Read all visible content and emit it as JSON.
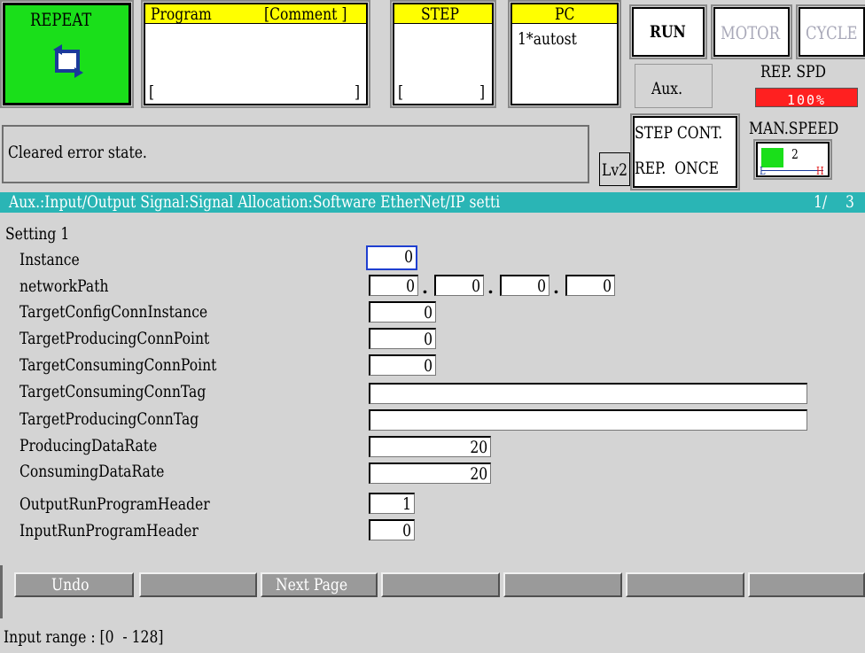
{
  "repeat": {
    "label": "REPEAT",
    "icon": "repeat-cycle-icon"
  },
  "program": {
    "label": "Program",
    "comment_label": "[Comment ]",
    "name_bracket_open": "[",
    "name_bracket_close": "]"
  },
  "step": {
    "label": "STEP",
    "bracket_open": "[",
    "bracket_close": "]"
  },
  "pc": {
    "label": "PC",
    "value": "1*autost"
  },
  "mode": {
    "run": "RUN",
    "motor": "MOTOR",
    "cycle": "CYCLE",
    "aux": "Aux."
  },
  "rep_spd": {
    "label": "REP. SPD",
    "value": "100%"
  },
  "man_speed": {
    "label": "MAN.SPEED",
    "value": "2",
    "low": "L",
    "high": "H",
    "level": 0.35
  },
  "step_cont": {
    "line1": "STEP CONT.",
    "line2": "REP.  ONCE"
  },
  "message": "Cleared error state.",
  "level": "Lv2",
  "breadcrumb": "Aux.:Input/Output Signal:Signal Allocation:Software EtherNet/IP setti",
  "page": {
    "current": "1/",
    "total": "3"
  },
  "section_title": "Setting 1",
  "settings": {
    "instance": {
      "label": "Instance",
      "value": "0"
    },
    "network_path": {
      "label": "networkPath",
      "o1": "0",
      "o2": "0",
      "o3": "0",
      "o4": "0",
      "sep": "."
    },
    "target_config_conn_instance": {
      "label": "TargetConfigConnInstance",
      "value": "0"
    },
    "target_producing_conn_point": {
      "label": "TargetProducingConnPoint",
      "value": "0"
    },
    "target_consuming_conn_point": {
      "label": "TargetConsumingConnPoint",
      "value": "0"
    },
    "target_consuming_conn_tag": {
      "label": "TargetConsumingConnTag",
      "value": ""
    },
    "target_producing_conn_tag": {
      "label": "TargetProducingConnTag",
      "value": ""
    },
    "producing_data_rate": {
      "label": "ProducingDataRate",
      "value": "20"
    },
    "consuming_data_rate": {
      "label": "ConsumingDataRate",
      "value": "20"
    },
    "output_run_program_header": {
      "label": "OutputRunProgramHeader",
      "value": "1"
    },
    "input_run_program_header": {
      "label": "InputRunProgramHeader",
      "value": "0"
    }
  },
  "function_keys": {
    "undo": "Undo",
    "f2": "",
    "next_page": "Next Page",
    "f4": "",
    "f5": "",
    "f6": "",
    "f7": ""
  },
  "input_range": "Input range : [0  - 128]",
  "colors": {
    "repeat_bg": "#1adf1a",
    "header_yellow": "#ffff00",
    "title_teal": "#2ab5b5",
    "speed_red": "#ff2020",
    "button_gray": "#9a9a9a"
  }
}
